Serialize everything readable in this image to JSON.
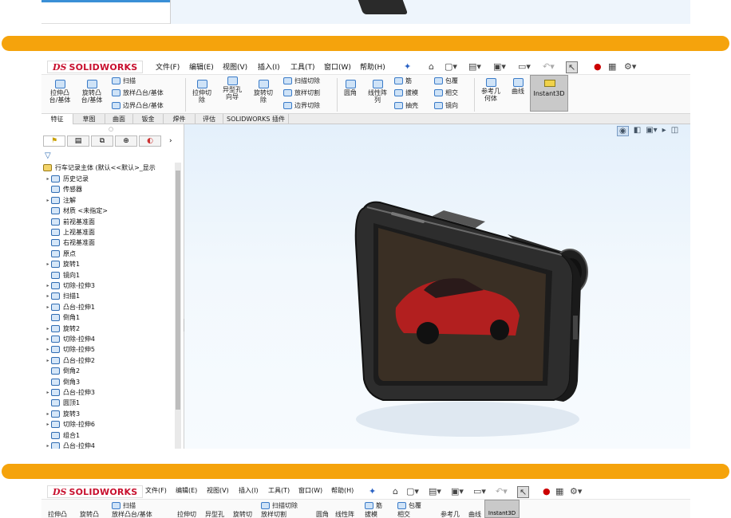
{
  "window": {
    "menus": [
      "文件(F)",
      "编辑(E)",
      "视图(V)",
      "插入(I)",
      "工具(T)",
      "窗口(W)",
      "帮助(H)"
    ],
    "logo_text": "SOLIDWORKS",
    "logo_mark": "DS"
  },
  "ribbon": {
    "extrude_boss": "拉伸凸\n台/基体",
    "revolve_boss": "旋转凸\n台/基体",
    "sweep": "扫描",
    "loft": "放样凸台/基体",
    "boundary": "边界凸台/基体",
    "extrude_cut": "拉伸切\n除",
    "hole_wizard": "异型孔\n向导",
    "revolve_cut": "旋转切\n除",
    "sweep_cut": "扫描切除",
    "loft_cut": "放样切割",
    "boundary_cut": "边界切除",
    "fillet": "圆角",
    "linear_pattern": "线性阵\n列",
    "rib": "筋",
    "draft": "拔模",
    "shell": "抽壳",
    "wrap": "包覆",
    "intersect": "相交",
    "mirror": "镜向",
    "ref_geometry": "参考几\n何体",
    "curves": "曲线",
    "instant3d": "Instant3D"
  },
  "tabs": [
    "特征",
    "草图",
    "曲面",
    "钣金",
    "焊件",
    "评估",
    "SOLIDWORKS 插件"
  ],
  "tree": {
    "root": "行车记录主体 (默认<<默认>_显示",
    "items": [
      {
        "label": "历史记录",
        "icon": "history-icon",
        "expand": true
      },
      {
        "label": "传感器",
        "icon": "sensor-icon",
        "expand": false
      },
      {
        "label": "注解",
        "icon": "annotation-icon",
        "expand": true
      },
      {
        "label": "材质 <未指定>",
        "icon": "material-icon",
        "expand": false
      },
      {
        "label": "前视基准面",
        "icon": "plane-icon",
        "expand": false
      },
      {
        "label": "上视基准面",
        "icon": "plane-icon",
        "expand": false
      },
      {
        "label": "右视基准面",
        "icon": "plane-icon",
        "expand": false
      },
      {
        "label": "原点",
        "icon": "origin-icon",
        "expand": false
      },
      {
        "label": "旋转1",
        "icon": "revolve-icon",
        "expand": true
      },
      {
        "label": "镜向1",
        "icon": "mirror-icon",
        "expand": false
      },
      {
        "label": "切除-拉伸3",
        "icon": "cut-extrude-icon",
        "expand": true
      },
      {
        "label": "扫描1",
        "icon": "sweep-icon",
        "expand": true
      },
      {
        "label": "凸台-拉伸1",
        "icon": "boss-extrude-icon",
        "expand": true
      },
      {
        "label": "倒角1",
        "icon": "chamfer-icon",
        "expand": false
      },
      {
        "label": "旋转2",
        "icon": "revolve-icon",
        "expand": true
      },
      {
        "label": "切除-拉伸4",
        "icon": "cut-extrude-icon",
        "expand": true
      },
      {
        "label": "切除-拉伸5",
        "icon": "cut-extrude-icon",
        "expand": true
      },
      {
        "label": "凸台-拉伸2",
        "icon": "boss-extrude-icon",
        "expand": true
      },
      {
        "label": "倒角2",
        "icon": "chamfer-icon",
        "expand": false
      },
      {
        "label": "倒角3",
        "icon": "chamfer-icon",
        "expand": false
      },
      {
        "label": "凸台-拉伸3",
        "icon": "boss-extrude-icon",
        "expand": true
      },
      {
        "label": "圆顶1",
        "icon": "dome-icon",
        "expand": false
      },
      {
        "label": "旋转3",
        "icon": "revolve-icon",
        "expand": true
      },
      {
        "label": "切除-拉伸6",
        "icon": "cut-extrude-icon",
        "expand": true
      },
      {
        "label": "组合1",
        "icon": "combine-icon",
        "expand": false
      },
      {
        "label": "凸台-拉伸4",
        "icon": "boss-extrude-icon",
        "expand": true
      }
    ]
  },
  "bottom_window": {
    "menus": [
      "文件(F)",
      "编辑(E)",
      "视图(V)",
      "插入(I)",
      "工具(T)",
      "窗口(W)",
      "帮助(H)"
    ],
    "ribbon_row1": [
      "扫描",
      "扫描切除",
      "筋",
      "包覆"
    ],
    "ribbon_row2": [
      "拉伸凸",
      "旋转凸",
      "放样凸台/基体",
      "拉伸切",
      "异型孔",
      "旋转切",
      "放样切割",
      "圆角",
      "线性阵",
      "拔模",
      "相交",
      "参考几",
      "曲线",
      "Instant3D"
    ]
  },
  "colors": {
    "accent_orange": "#f5a30c",
    "sw_red": "#c8102e",
    "viewport_top": "#e4f0fb"
  }
}
